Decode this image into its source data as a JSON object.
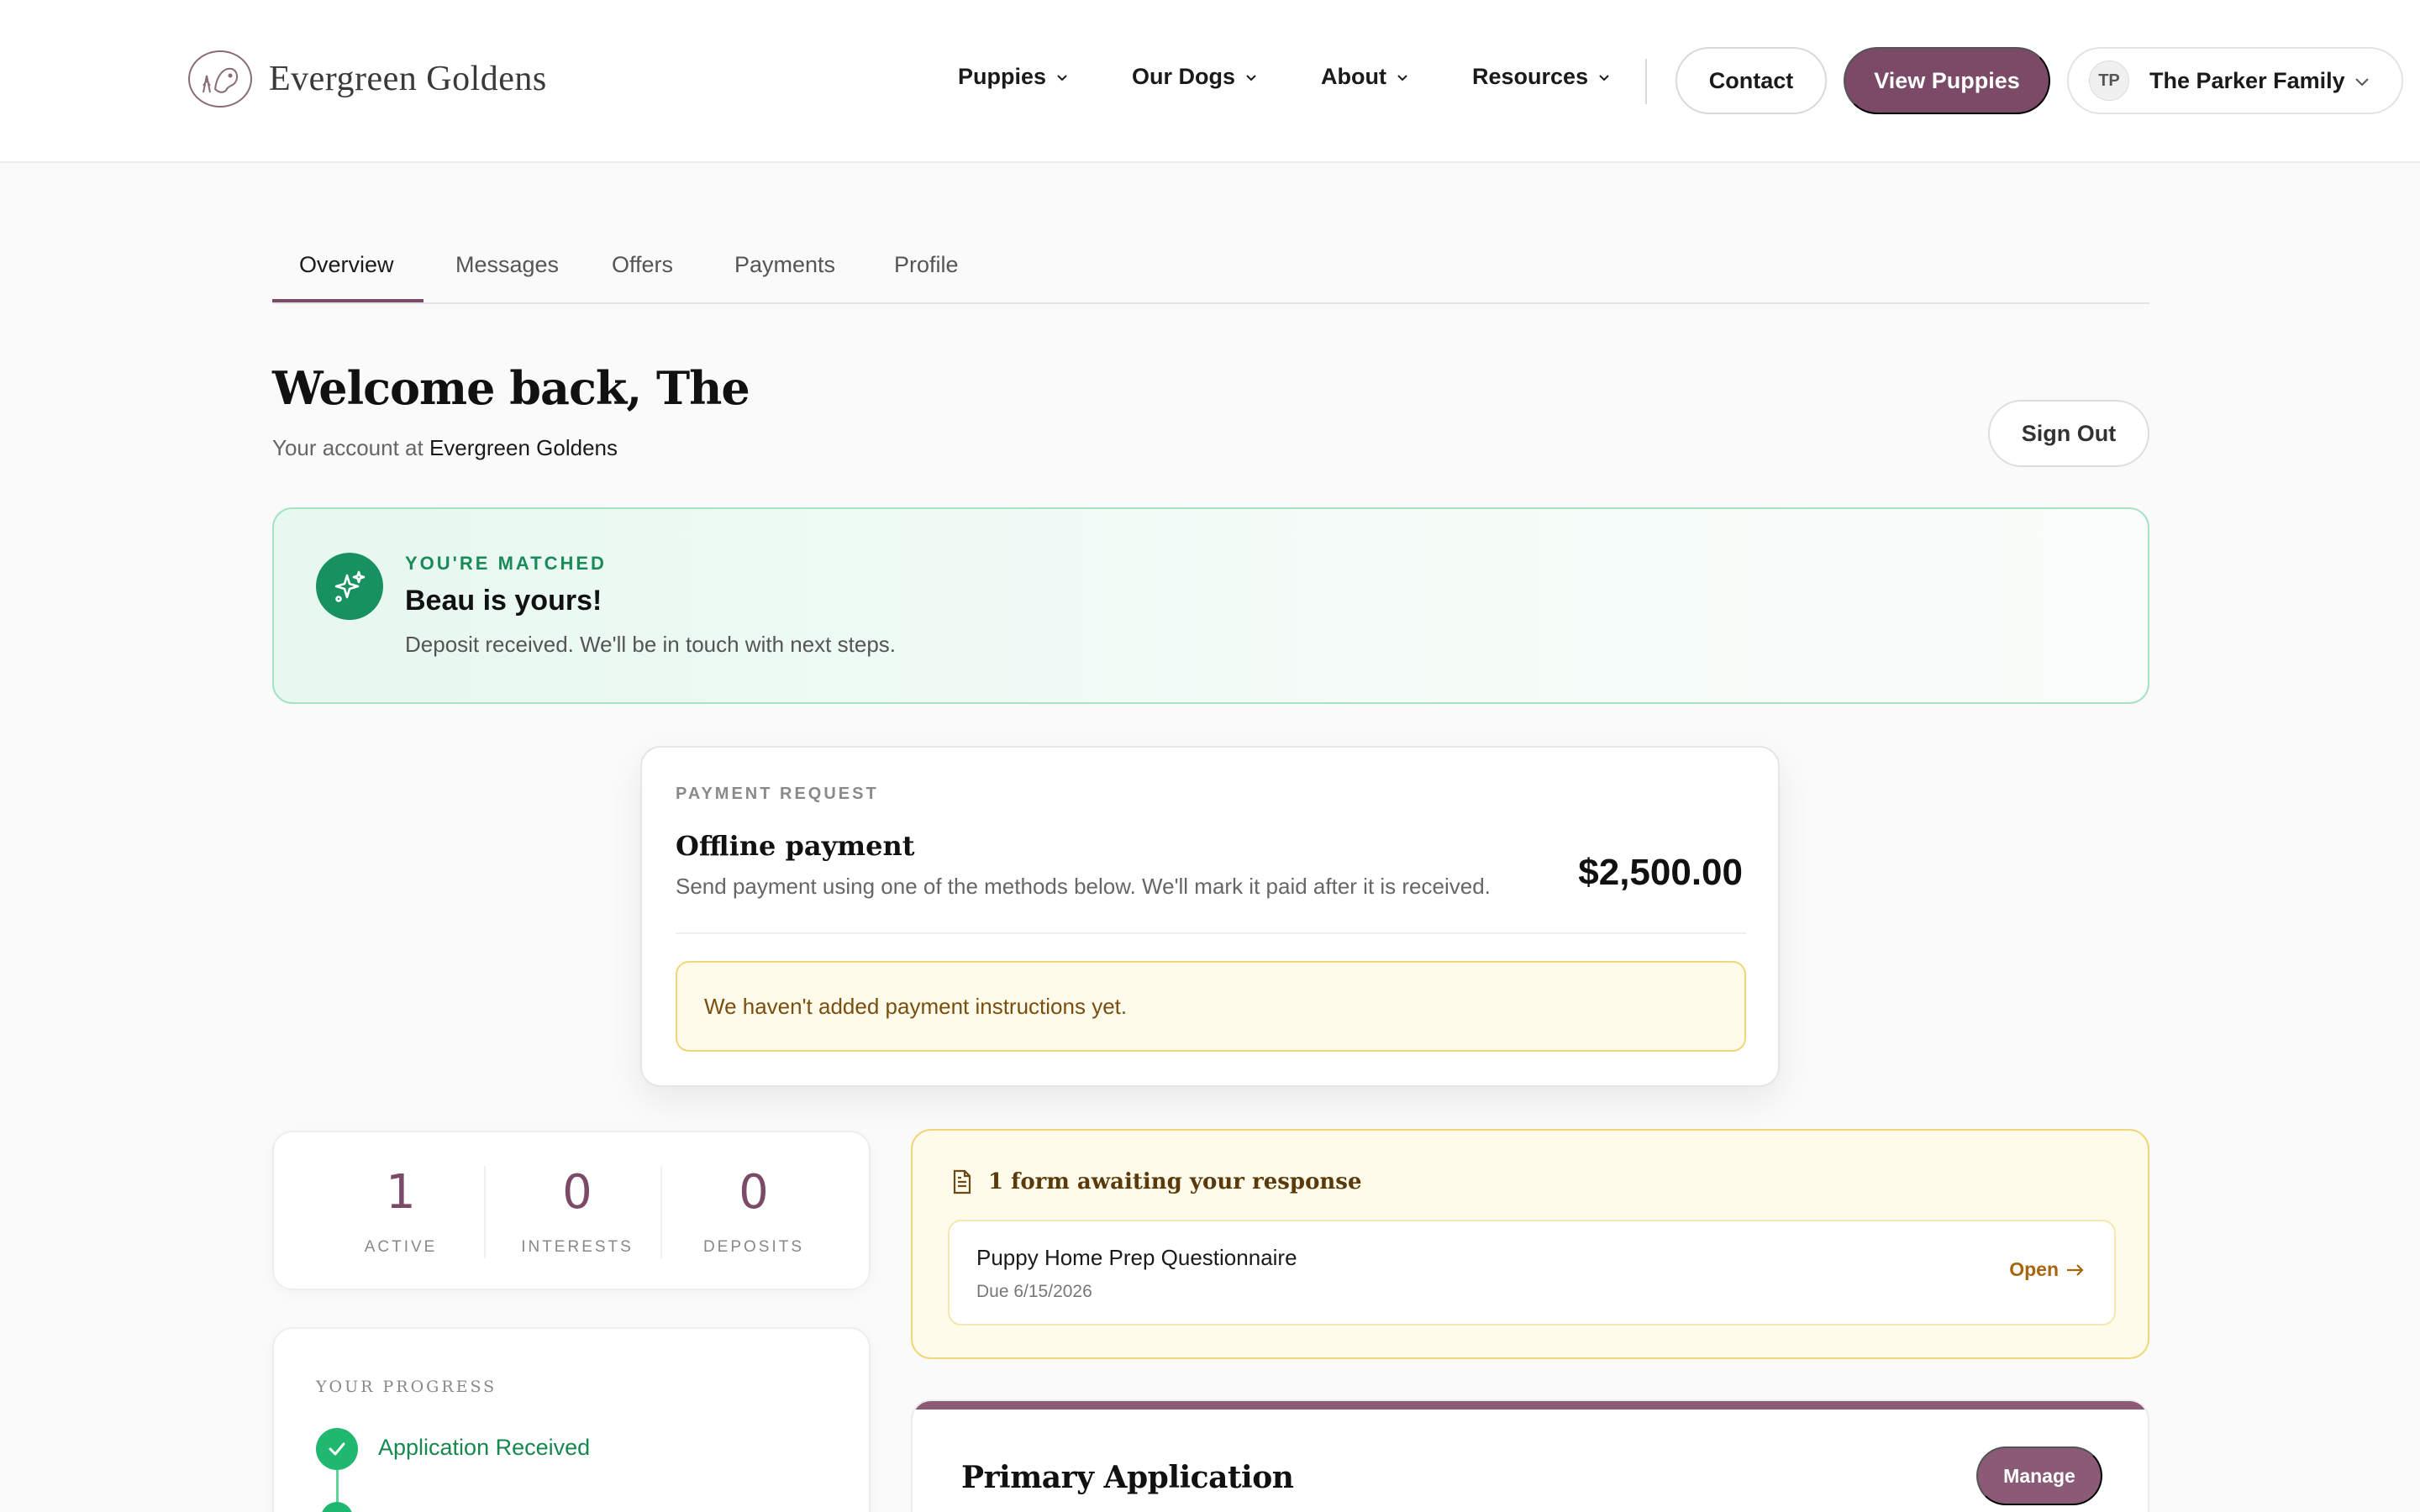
{
  "brand": {
    "name": "Evergreen Goldens",
    "accent_color": "#7a4a66",
    "success_color": "#16915f",
    "warning_color": "#f0d679"
  },
  "nav": {
    "items": [
      {
        "label": "Puppies",
        "icon": "chevron-down-icon"
      },
      {
        "label": "Our Dogs",
        "icon": "chevron-down-icon"
      },
      {
        "label": "About",
        "icon": "chevron-down-icon"
      },
      {
        "label": "Resources",
        "icon": "chevron-down-icon"
      }
    ],
    "contact_label": "Contact",
    "view_puppies_label": "View Puppies"
  },
  "user": {
    "initials": "TP",
    "name": "The Parker Family"
  },
  "tabs": [
    {
      "label": "Overview",
      "active": true
    },
    {
      "label": "Messages",
      "active": false
    },
    {
      "label": "Offers",
      "active": false
    },
    {
      "label": "Payments",
      "active": false
    },
    {
      "label": "Profile",
      "active": false
    }
  ],
  "welcome": {
    "title": "Welcome back, The",
    "account_prefix": "Your account at",
    "account_name": "Evergreen Goldens",
    "sign_out_label": "Sign Out"
  },
  "matched": {
    "icon": "sparkles-icon",
    "label": "YOU'RE MATCHED",
    "title": "Beau is yours!",
    "subtitle": "Deposit received. We'll be in touch with next steps."
  },
  "payment": {
    "label": "PAYMENT REQUEST",
    "title": "Offline payment",
    "subtitle": "Send payment using one of the methods below. We'll mark it paid after it is received.",
    "amount": "$2,500.00",
    "notice": "We haven't added payment instructions yet."
  },
  "stats": [
    {
      "value": "1",
      "label": "ACTIVE"
    },
    {
      "value": "0",
      "label": "INTERESTS"
    },
    {
      "value": "0",
      "label": "DEPOSITS"
    }
  ],
  "progress": {
    "label": "YOUR PROGRESS",
    "steps": [
      {
        "label": "Application Received",
        "done": true
      }
    ]
  },
  "forms": {
    "icon": "document-icon",
    "title": "1 form awaiting your response",
    "items": [
      {
        "name": "Puppy Home Prep Questionnaire",
        "due": "Due 6/15/2026",
        "action": "Open"
      }
    ]
  },
  "application": {
    "title": "Primary Application",
    "manage_label": "Manage"
  }
}
